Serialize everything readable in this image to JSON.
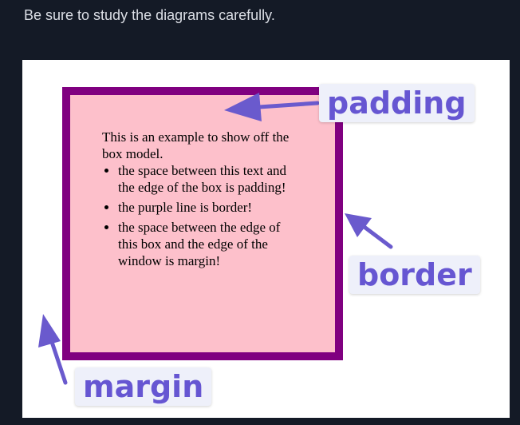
{
  "instruction": "Be sure to study the diagrams carefully.",
  "diagram": {
    "box": {
      "intro": "This is an example to show off the box model.",
      "bullets": [
        "the space between this text and the edge of the box is padding!",
        "the purple line is border!",
        "the space between the edge of this box and the edge of the window is margin!"
      ]
    },
    "labels": {
      "padding": "padding",
      "border": "border",
      "margin": "margin"
    }
  },
  "colors": {
    "page_background": "#141a26",
    "box_background": "#fdc0cb",
    "box_border": "#800080",
    "label_text": "#6656d2",
    "label_background": "#eef0fa",
    "arrow": "#6a5acd"
  }
}
